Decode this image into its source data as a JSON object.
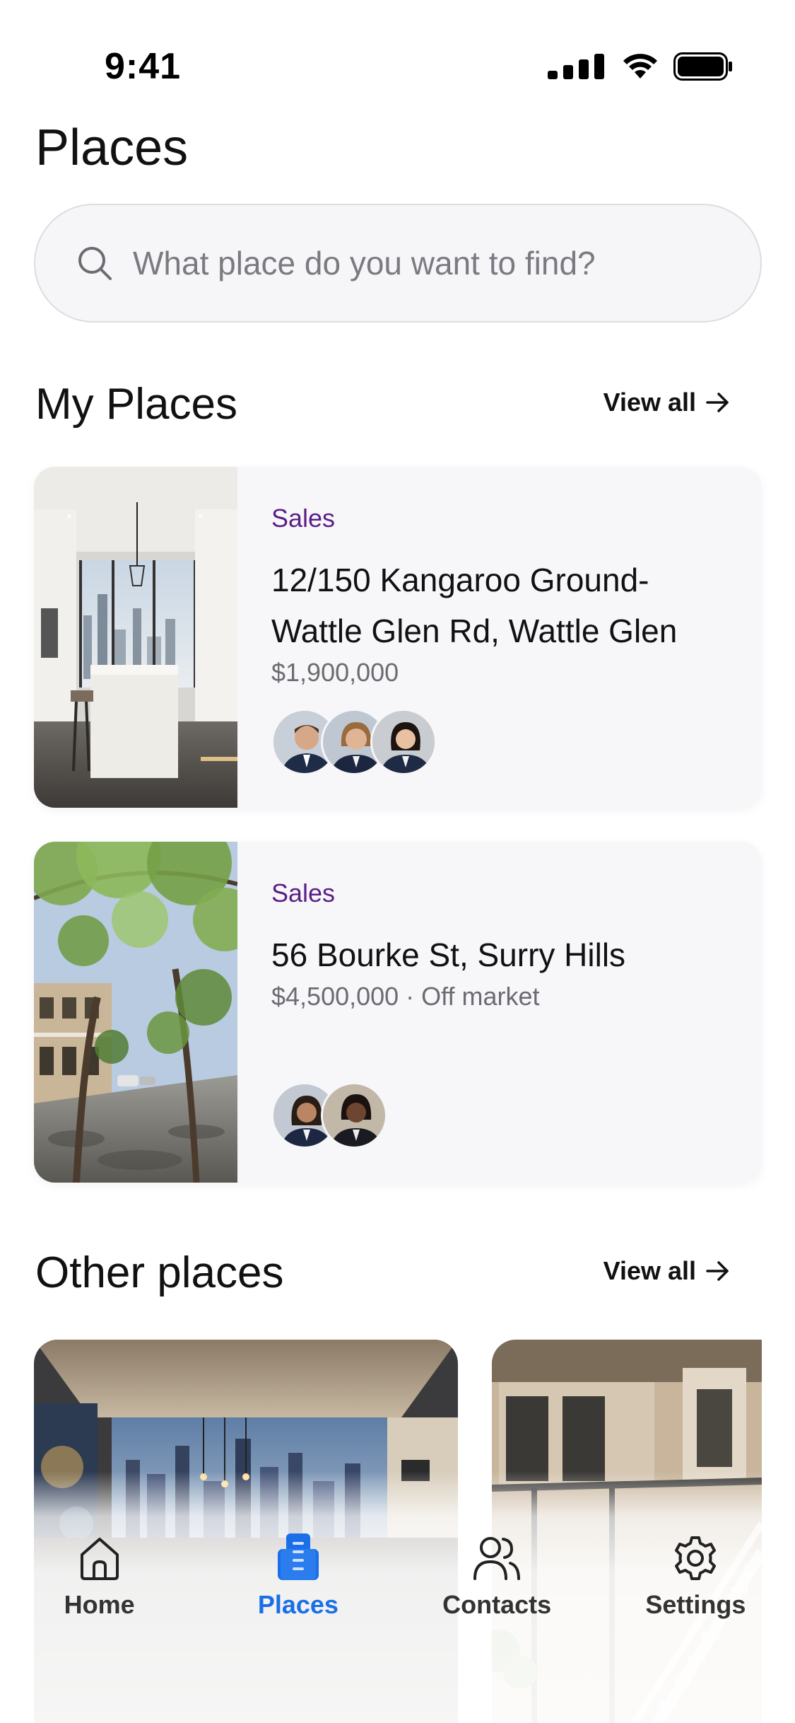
{
  "status_bar": {
    "time": "9:41"
  },
  "page_title": "Places",
  "search": {
    "placeholder": "What place do you want to find?",
    "value": ""
  },
  "my_places": {
    "title": "My Places",
    "view_all": "View all",
    "items": [
      {
        "category": "Sales",
        "address": "12/150 Kangaroo Ground-Wattle Glen Rd, Wattle Glen",
        "price": "$1,900,000",
        "agent_count": 3
      },
      {
        "category": "Sales",
        "address": "56 Bourke St, Surry Hills",
        "price": "$4,500,000 · Off market",
        "agent_count": 2
      }
    ]
  },
  "other_places": {
    "title": "Other places",
    "view_all": "View all"
  },
  "tab_bar": {
    "items": [
      {
        "label": "Home",
        "icon": "home-icon",
        "active": false
      },
      {
        "label": "Places",
        "icon": "building-icon",
        "active": true
      },
      {
        "label": "Contacts",
        "icon": "contacts-icon",
        "active": false
      },
      {
        "label": "Settings",
        "icon": "gear-icon",
        "active": false
      }
    ]
  },
  "colors": {
    "accent": "#1a6fe8",
    "category": "#5a1f86",
    "card_bg": "#f7f7fa"
  }
}
